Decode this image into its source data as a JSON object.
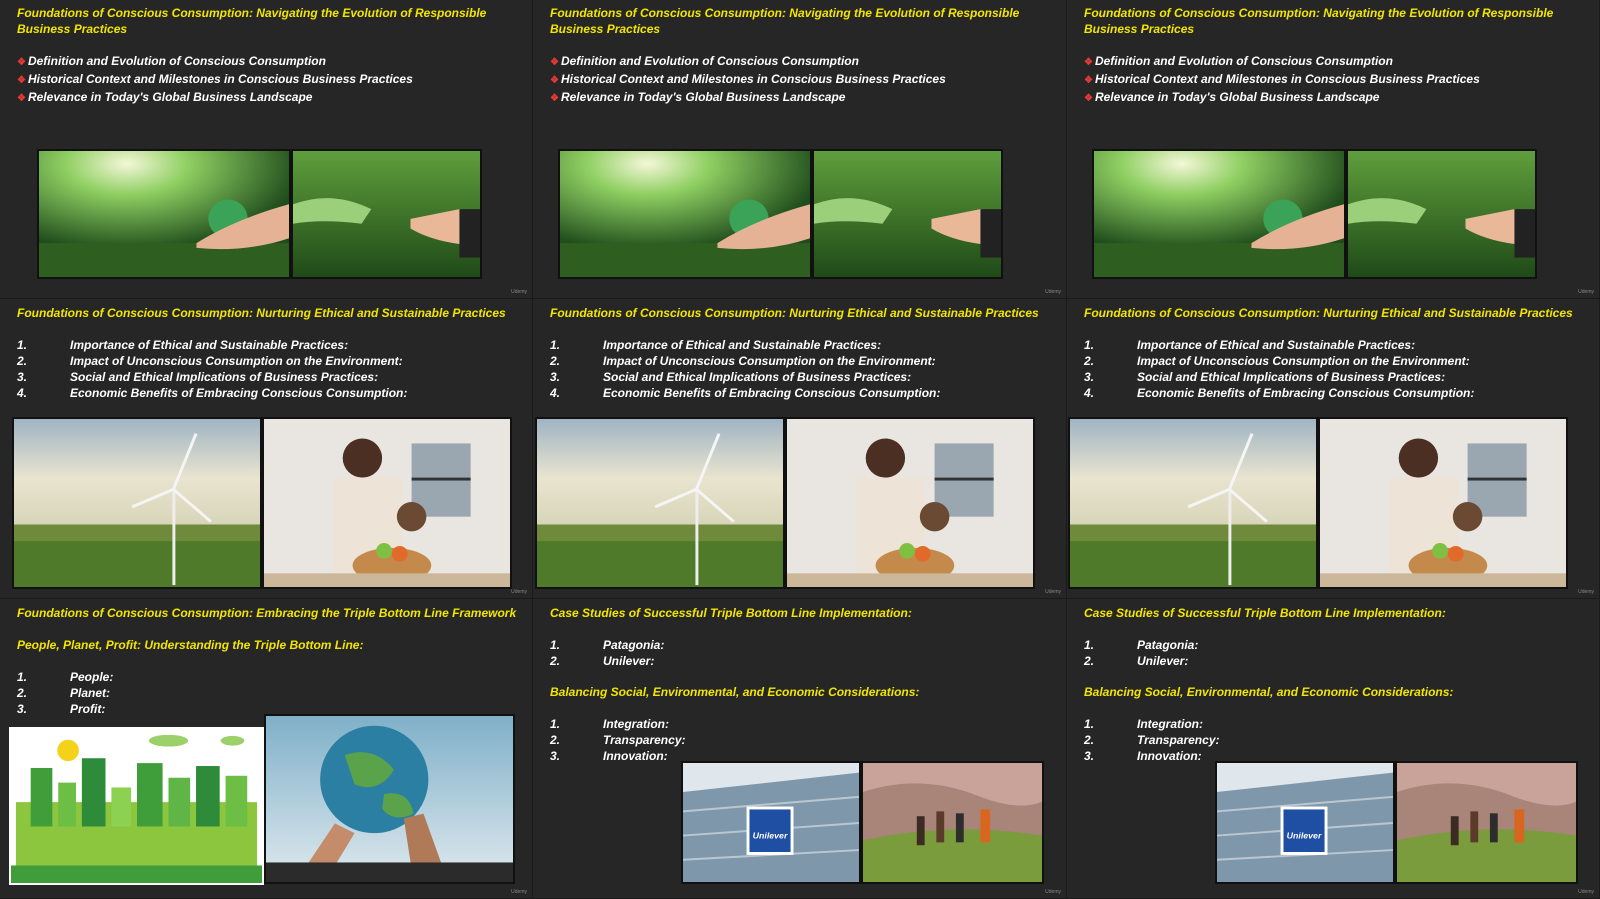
{
  "slide1": {
    "title": "Foundations of Conscious Consumption: Navigating the Evolution of Responsible Business Practices",
    "bullets": [
      "Definition and Evolution of Conscious Consumption",
      "Historical Context and Milestones in Conscious Business Practices",
      "Relevance in Today's Global Business Landscape"
    ]
  },
  "slide2": {
    "title": "Foundations of Conscious Consumption: Nurturing Ethical and Sustainable Practices",
    "items": [
      {
        "num": "1.",
        "text": "Importance of Ethical and Sustainable Practices:"
      },
      {
        "num": "2.",
        "text": "Impact of Unconscious Consumption on the Environment:"
      },
      {
        "num": "3.",
        "text": "Social and Ethical Implications of Business Practices:"
      },
      {
        "num": "4.",
        "text": "Economic Benefits of Embracing Conscious Consumption:"
      }
    ]
  },
  "slide3": {
    "title": "Foundations of Conscious Consumption: Embracing the Triple Bottom Line Framework",
    "subtitle": "People, Planet, Profit: Understanding the Triple Bottom Line:",
    "items": [
      {
        "num": "1.",
        "text": "People:"
      },
      {
        "num": "2.",
        "text": "Planet:"
      },
      {
        "num": "3.",
        "text": "Profit:"
      }
    ]
  },
  "slide4": {
    "title": "Case Studies of Successful Triple Bottom Line Implementation:",
    "items": [
      {
        "num": "1.",
        "text": "Patagonia:"
      },
      {
        "num": "2.",
        "text": "Unilever:"
      }
    ],
    "subtitle": "Balancing Social, Environmental, and Economic Considerations:",
    "items2": [
      {
        "num": "1.",
        "text": "Integration:"
      },
      {
        "num": "2.",
        "text": "Transparency:"
      },
      {
        "num": "3.",
        "text": "Innovation:"
      }
    ],
    "logo_text": "Unilever"
  },
  "watermark": "Udemy",
  "colors": {
    "background": "#202020",
    "slide": "#262626",
    "heading": "#f2e600",
    "body_text": "#ffffff",
    "bullet": "#e53935"
  },
  "bullet_icon": "red-diamond-bullet-icon"
}
